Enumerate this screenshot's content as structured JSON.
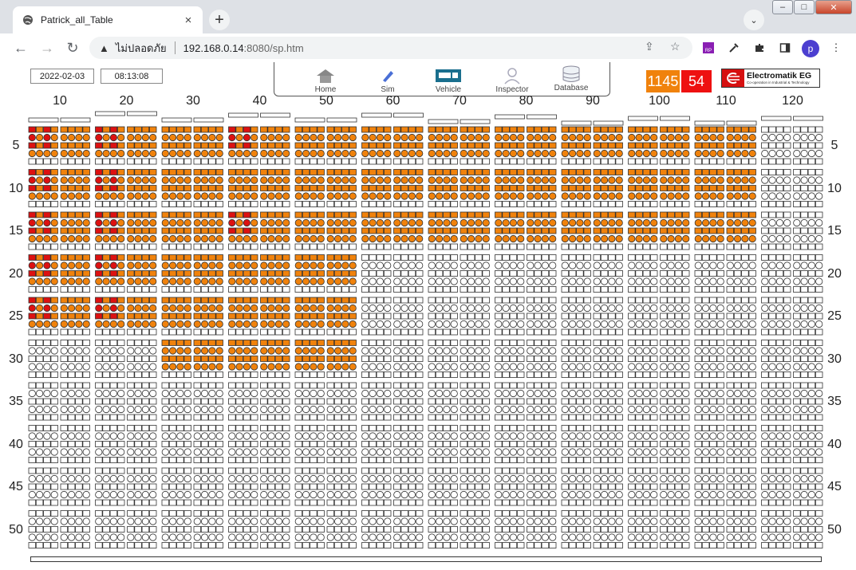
{
  "browser": {
    "tab_title": "Patrick_all_Table",
    "tab_close": "×",
    "new_tab": "+",
    "tab_search": "⌄",
    "win_min": "–",
    "win_max": "□",
    "win_close": "✕",
    "back": "←",
    "forward": "→",
    "reload": "↻",
    "security_label": "ไม่ปลอดภัย",
    "url_host": "192.168.0.14",
    "url_rest": ":8080/sp.htm",
    "profile_initial": "p",
    "ext_rp_label": "RP",
    "icons": [
      "globe-icon",
      "close-icon",
      "plus-icon",
      "chevron-down-icon",
      "warning-icon",
      "share-icon",
      "star-icon",
      "eyedropper-icon",
      "puzzle-icon",
      "sidepanel-icon",
      "more-icon"
    ]
  },
  "header": {
    "date": "2022-02-03",
    "time": "08:13:08",
    "nav": [
      {
        "label": "Home",
        "icon": "home-icon"
      },
      {
        "label": "Sim",
        "icon": "pencil-icon"
      },
      {
        "label": "Vehicle",
        "icon": "truck-icon"
      },
      {
        "label": "Inspector",
        "icon": "person-icon"
      },
      {
        "label": "Database",
        "icon": "database-icon"
      }
    ],
    "count_orange": "1145",
    "count_red": "54",
    "logo_name": "Electromatik EG",
    "logo_sub": "Co-operation in Industrial & Technology"
  },
  "grid": {
    "column_labels": [
      "10",
      "20",
      "30",
      "40",
      "50",
      "60",
      "70",
      "80",
      "90",
      "100",
      "110",
      "120"
    ],
    "row_labels": [
      "5",
      "10",
      "15",
      "20",
      "25",
      "30",
      "35",
      "40",
      "45",
      "50"
    ],
    "colors": {
      "full": "#f0820c",
      "alert": "#dd1111",
      "empty": "#ffffff",
      "stroke": "#333333"
    },
    "block_cols": 12,
    "block_rows": 10,
    "filled_blocks": [
      [
        1,
        1,
        1,
        1,
        1,
        1,
        1,
        1,
        1,
        1,
        1,
        0
      ],
      [
        1,
        1,
        1,
        1,
        1,
        1,
        1,
        1,
        1,
        1,
        1,
        0
      ],
      [
        1,
        1,
        1,
        1,
        1,
        1,
        1,
        1,
        1,
        1,
        1,
        0
      ],
      [
        1,
        1,
        1,
        1,
        1,
        0,
        0,
        0,
        0,
        0,
        0,
        0
      ],
      [
        1,
        1,
        1,
        1,
        1,
        0,
        0,
        0,
        0,
        0,
        0,
        0
      ],
      [
        0,
        0,
        1,
        1,
        1,
        0,
        0,
        0,
        0,
        0,
        0,
        0
      ],
      [
        0,
        0,
        0,
        0,
        0,
        0,
        0,
        0,
        0,
        0,
        0,
        0
      ],
      [
        0,
        0,
        0,
        0,
        0,
        0,
        0,
        0,
        0,
        0,
        0,
        0
      ],
      [
        0,
        0,
        0,
        0,
        0,
        0,
        0,
        0,
        0,
        0,
        0,
        0
      ],
      [
        0,
        0,
        0,
        0,
        0,
        0,
        0,
        0,
        0,
        0,
        0,
        0
      ]
    ],
    "alert_blocks": [
      [
        1,
        1,
        0,
        1,
        0,
        0,
        0,
        0,
        0,
        0,
        0,
        0
      ],
      [
        1,
        1,
        0,
        0,
        0,
        0,
        0,
        0,
        0,
        0,
        0,
        0
      ],
      [
        1,
        1,
        0,
        1,
        0,
        0,
        0,
        0,
        0,
        0,
        0,
        0
      ],
      [
        1,
        1,
        0,
        0,
        0,
        0,
        0,
        0,
        0,
        0,
        0,
        0
      ],
      [
        1,
        1,
        0,
        0,
        0,
        0,
        0,
        0,
        0,
        0,
        0,
        0
      ],
      [
        0,
        0,
        0,
        0,
        0,
        0,
        0,
        0,
        0,
        0,
        0,
        0
      ],
      [
        0,
        0,
        0,
        0,
        0,
        0,
        0,
        0,
        0,
        0,
        0,
        0
      ],
      [
        0,
        0,
        0,
        0,
        0,
        0,
        0,
        0,
        0,
        0,
        0,
        0
      ],
      [
        0,
        0,
        0,
        0,
        0,
        0,
        0,
        0,
        0,
        0,
        0,
        0
      ],
      [
        0,
        0,
        0,
        0,
        0,
        0,
        0,
        0,
        0,
        0,
        0,
        0
      ]
    ]
  }
}
